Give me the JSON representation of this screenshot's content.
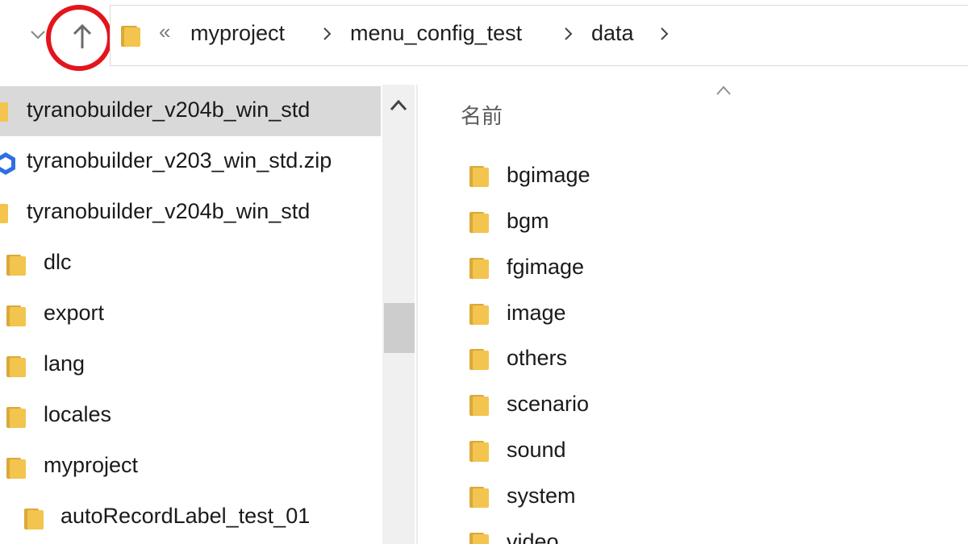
{
  "colors": {
    "folder": "#f3c44e",
    "folder_dark": "#dba83a",
    "annotation": "#e3151c",
    "selection": "#d9d9d9",
    "zip_blue": "#2f6fe0"
  },
  "address_bar": {
    "overflow": "«",
    "breadcrumbs": [
      "myproject",
      "menu_config_test",
      "data"
    ]
  },
  "nav_pane": {
    "items": [
      {
        "label": "tyranobuilder_v204b_win_std",
        "icon": "folder-icon",
        "selected": true
      },
      {
        "label": "tyranobuilder_v203_win_std.zip",
        "icon": "zip-archive-icon"
      },
      {
        "label": "tyranobuilder_v204b_win_std",
        "icon": "folder-icon"
      },
      {
        "label": "dlc",
        "icon": "folder-icon"
      },
      {
        "label": "export",
        "icon": "folder-icon"
      },
      {
        "label": "lang",
        "icon": "folder-icon"
      },
      {
        "label": "locales",
        "icon": "folder-icon"
      },
      {
        "label": "myproject",
        "icon": "folder-icon"
      },
      {
        "label": "autoRecordLabel_test_01",
        "icon": "folder-icon"
      }
    ]
  },
  "file_list": {
    "column_header": "名前",
    "items": [
      "bgimage",
      "bgm",
      "fgimage",
      "image",
      "others",
      "scenario",
      "sound",
      "system",
      "video"
    ]
  }
}
